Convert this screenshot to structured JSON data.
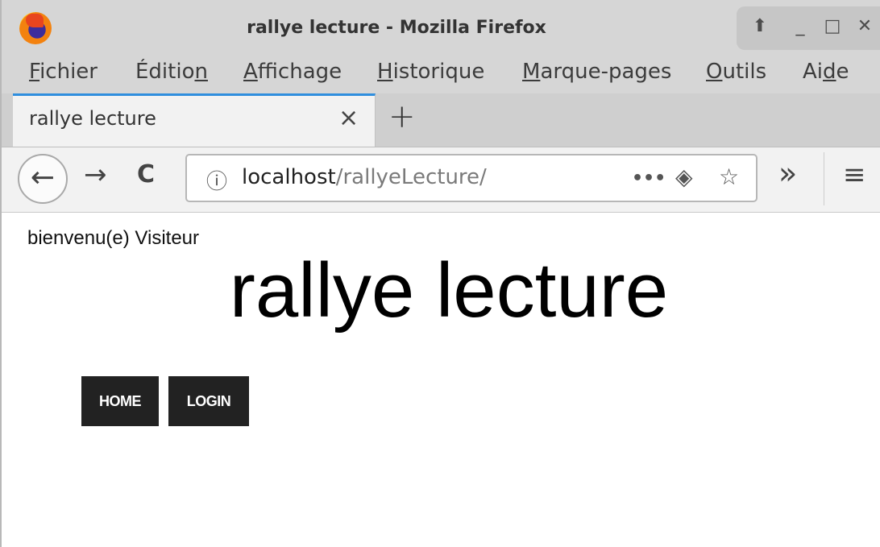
{
  "window": {
    "title": "rallye lecture - Mozilla Firefox",
    "controls": {
      "restore": "⬆",
      "minimize": "_",
      "maximize": "□",
      "close": "✕"
    }
  },
  "menu": {
    "items": [
      {
        "pre": "",
        "key": "F",
        "post": "ichier"
      },
      {
        "pre": "Éditio",
        "key": "n",
        "post": ""
      },
      {
        "pre": "",
        "key": "A",
        "post": "ffichage"
      },
      {
        "pre": "",
        "key": "H",
        "post": "istorique"
      },
      {
        "pre": "",
        "key": "M",
        "post": "arque-pages"
      },
      {
        "pre": "",
        "key": "O",
        "post": "utils"
      },
      {
        "pre": "Ai",
        "key": "d",
        "post": "e"
      }
    ]
  },
  "tabs": {
    "active_title": "rallye lecture",
    "close_glyph": "×",
    "new_tab_glyph": "+"
  },
  "nav": {
    "back_glyph": "←",
    "forward_glyph": "→",
    "reload_glyph": "C",
    "info_glyph": "ⓘ",
    "url_host": "localhost",
    "url_path": "/rallyeLecture/",
    "more_glyph": "•••",
    "pocket_glyph": "◈",
    "star_glyph": "☆",
    "overflow_glyph": "»",
    "menu_glyph": "≡"
  },
  "page": {
    "welcome": "bienvenu(e) Visiteur",
    "title": "rallye lecture",
    "buttons": {
      "home": "HOME",
      "login": "LOGIN"
    }
  },
  "colors": {
    "tab_accent": "#2f8ede",
    "button_bg": "#222222",
    "chrome_bg": "#d6d6d6"
  }
}
